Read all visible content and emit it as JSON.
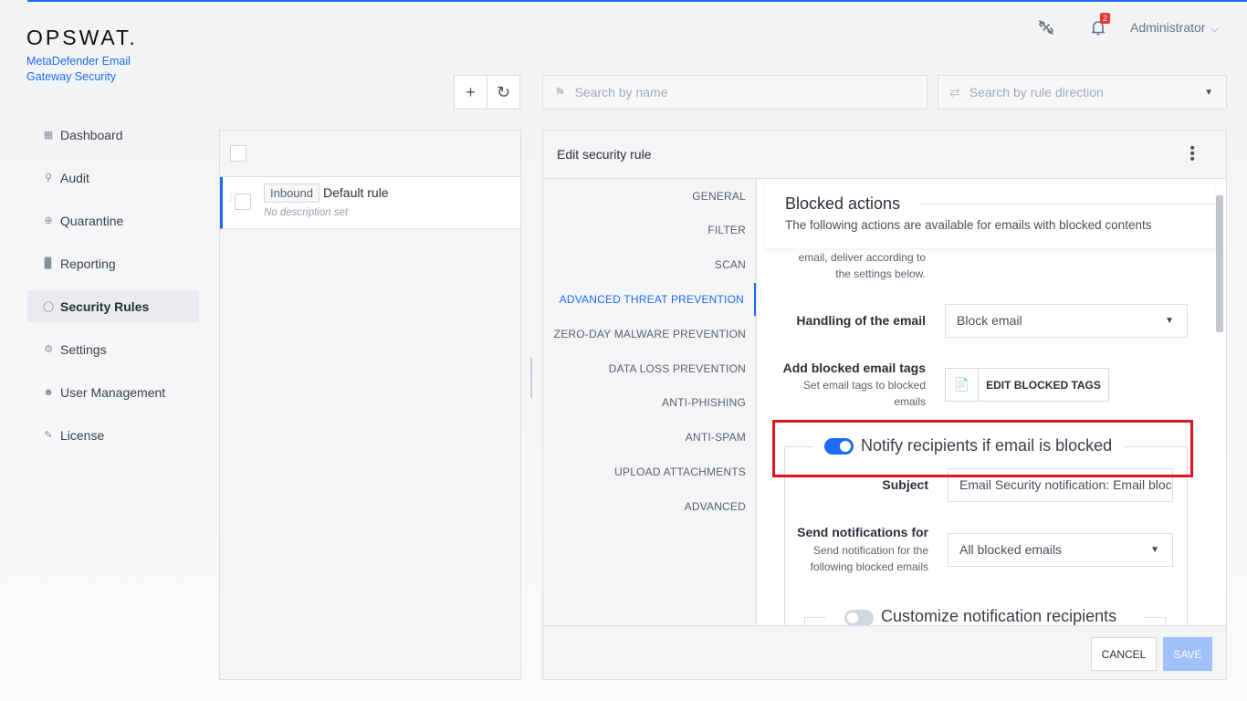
{
  "logo": {
    "brand": "OPSWAT.",
    "product": "MetaDefender Email Gateway Security"
  },
  "header": {
    "notification_count": "2",
    "user": "Administrator"
  },
  "sidebar": {
    "items": [
      {
        "label": "Dashboard",
        "icon": "grid-icon"
      },
      {
        "label": "Audit",
        "icon": "audit-icon"
      },
      {
        "label": "Quarantine",
        "icon": "globe-icon"
      },
      {
        "label": "Reporting",
        "icon": "chart-icon"
      },
      {
        "label": "Security Rules",
        "icon": "shield-icon",
        "active": true
      },
      {
        "label": "Settings",
        "icon": "gear-icon"
      },
      {
        "label": "User Management",
        "icon": "user-icon"
      },
      {
        "label": "License",
        "icon": "license-icon"
      }
    ]
  },
  "toolbar": {
    "search_name_placeholder": "Search by name",
    "search_direction_placeholder": "Search by rule direction"
  },
  "rules": [
    {
      "direction": "Inbound",
      "name": "Default rule",
      "description": "No description set"
    }
  ],
  "editor": {
    "title": "Edit security rule",
    "tabs": [
      "GENERAL",
      "FILTER",
      "SCAN",
      "ADVANCED THREAT PREVENTION",
      "ZERO-DAY MALWARE PREVENTION",
      "DATA LOSS PREVENTION",
      "ANTI-PHISHING",
      "ANTI-SPAM",
      "UPLOAD ATTACHMENTS",
      "ADVANCED"
    ],
    "active_tab": "ADVANCED THREAT PREVENTION",
    "section": {
      "title": "Blocked actions",
      "subtitle": "The following actions are available for emails with blocked contents",
      "partial_text_line1": "email, deliver according to",
      "partial_text_line2": "the settings below."
    },
    "handling": {
      "label": "Handling of the email",
      "value": "Block email"
    },
    "tags": {
      "label": "Add blocked email tags",
      "sub_line1": "Set email tags to blocked",
      "sub_line2": "emails",
      "button": "EDIT BLOCKED TAGS"
    },
    "notify": {
      "toggle_label": "Notify recipients if email is blocked",
      "enabled": true,
      "subject_label": "Subject",
      "subject_value": "Email Security notification: Email blocked",
      "send_label": "Send notifications for",
      "send_sub_line1": "Send notification for the",
      "send_sub_line2": "following blocked emails",
      "send_value": "All blocked emails"
    },
    "customize": {
      "toggle_label": "Customize notification recipients",
      "enabled": false
    },
    "cancel_label": "CANCEL",
    "save_label": "SAVE"
  },
  "colors": {
    "accent": "#1d6bf3",
    "highlight": "#e1141e",
    "badge": "#e53935"
  }
}
